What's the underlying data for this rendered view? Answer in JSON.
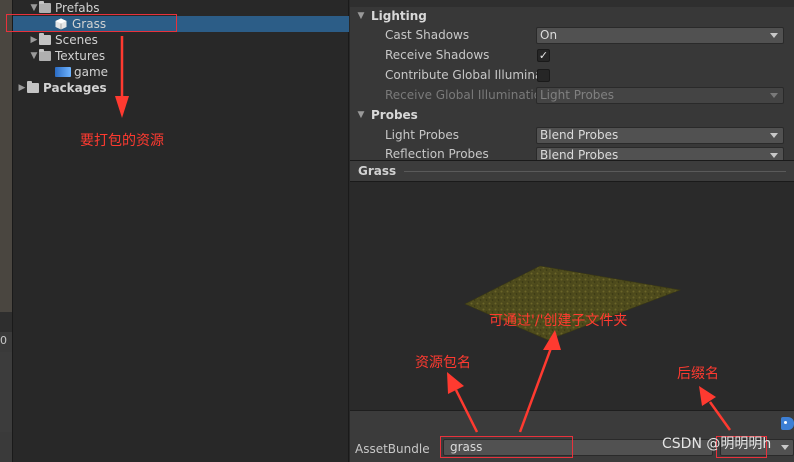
{
  "scene_strip": {
    "value": "0"
  },
  "project": {
    "items": [
      {
        "label": "Prefabs",
        "state": "expanded",
        "icon": "folder-open-icon"
      },
      {
        "label": "Grass",
        "state": "selected",
        "icon": "prefab-cube-icon"
      },
      {
        "label": "Scenes",
        "state": "collapsed",
        "icon": "folder-icon"
      },
      {
        "label": "Textures",
        "state": "expanded",
        "icon": "folder-open-icon"
      },
      {
        "label": "game",
        "state": "leaf",
        "icon": "texture-icon"
      },
      {
        "label": "Packages",
        "state": "collapsed",
        "icon": "folder-icon"
      }
    ]
  },
  "inspector": {
    "lighting_header": "Lighting",
    "cast_shadows_label": "Cast Shadows",
    "cast_shadows_value": "On",
    "receive_shadows_label": "Receive Shadows",
    "receive_shadows_checked": "✓",
    "contribute_gi_label": "Contribute Global Illuminat",
    "receive_gi_label": "Receive Global Illumination",
    "receive_gi_value": "Light Probes",
    "probes_header": "Probes",
    "light_probes_label": "Light Probes",
    "light_probes_value": "Blend Probes",
    "reflection_probes_label": "Reflection Probes",
    "reflection_probes_value": "Blend Probes"
  },
  "preview": {
    "title": "Grass"
  },
  "asset_bundle": {
    "label": "AssetBundle",
    "name_value": "grass",
    "variant_value": ""
  },
  "annotations": {
    "asset_to_pack": "要打包的资源",
    "subfolder_hint": "可通过'/'创建子文件夹",
    "bundle_name": "资源包名",
    "suffix_name": "后缀名"
  },
  "watermark": "CSDN @明明明h",
  "colors": {
    "selection": "#2c5d87",
    "annotation_red": "#ff3a30",
    "tag_blue": "#3d7fd4"
  }
}
